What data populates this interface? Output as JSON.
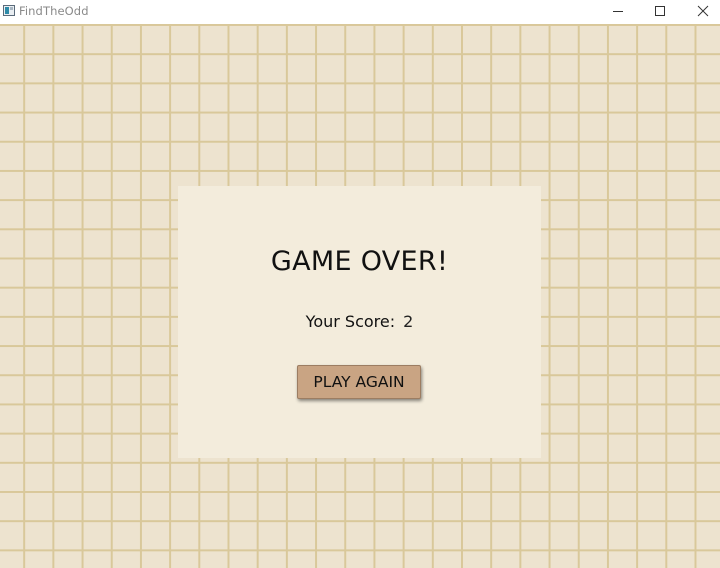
{
  "window": {
    "title": "FindTheOdd",
    "icon": "app-icon",
    "controls": [
      "minimize-icon",
      "maximize-icon",
      "close-icon"
    ]
  },
  "board": {
    "background_color": "#ede3cf",
    "grid_line_color": "#d9c89a"
  },
  "dialog": {
    "title": "GAME OVER!",
    "score_label": "Your Score:",
    "score_value": "2",
    "button_label": "PLAY AGAIN",
    "background_color": "#f3ecdc",
    "button_color": "#c9a483"
  }
}
